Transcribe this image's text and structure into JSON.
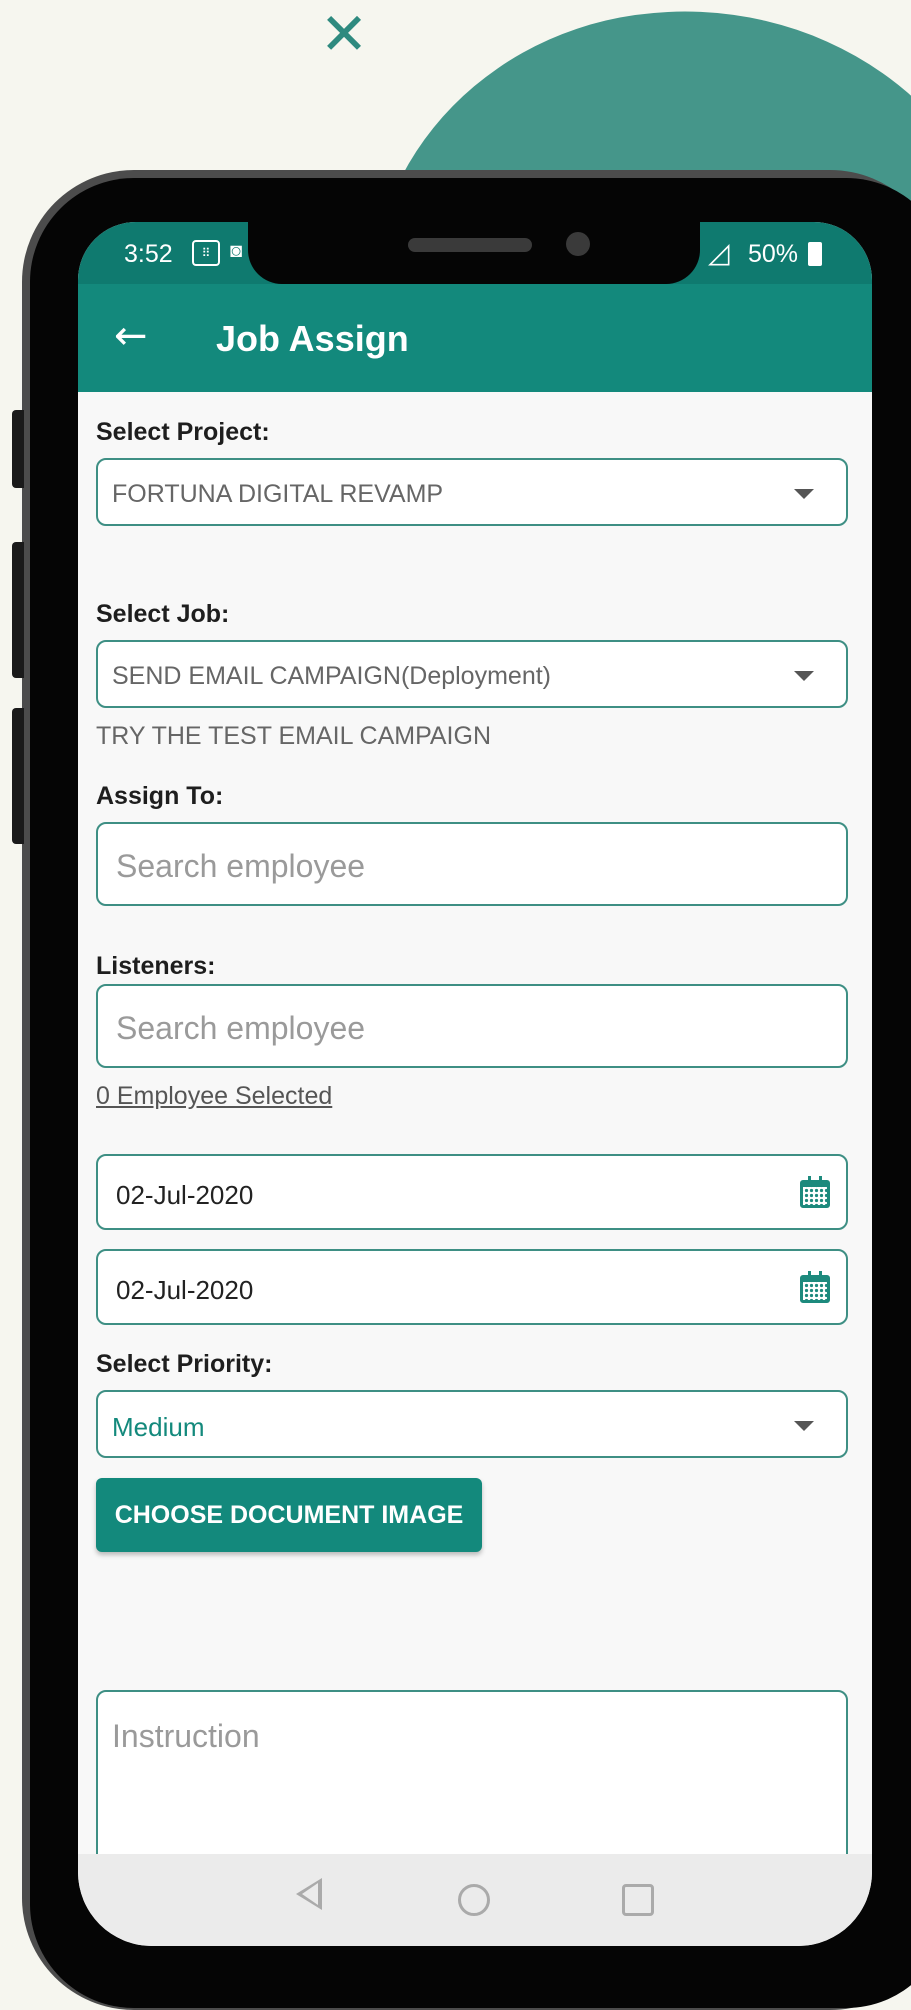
{
  "status_bar": {
    "time": "3:52",
    "battery": "50%"
  },
  "header": {
    "title": "Job Assign",
    "back_icon": "arrow-left-icon"
  },
  "form": {
    "project_label": "Select Project:",
    "project_value": "FORTUNA DIGITAL REVAMP",
    "job_label": "Select Job:",
    "job_value": "SEND EMAIL CAMPAIGN(Deployment)",
    "job_description": "TRY THE TEST EMAIL CAMPAIGN",
    "assign_label": "Assign To:",
    "assign_placeholder": "Search employee",
    "listeners_label": "Listeners:",
    "listeners_placeholder": "Search employee",
    "employee_selected": "0 Employee Selected",
    "start_date": "02-Jul-2020",
    "end_date": "02-Jul-2020",
    "priority_label": "Select Priority:",
    "priority_value": "Medium",
    "choose_button": "CHOOSE DOCUMENT IMAGE",
    "instruction_placeholder": "Instruction"
  },
  "colors": {
    "primary": "#13897c",
    "accent_blob": "#45968a",
    "background": "#f6f6ef"
  }
}
